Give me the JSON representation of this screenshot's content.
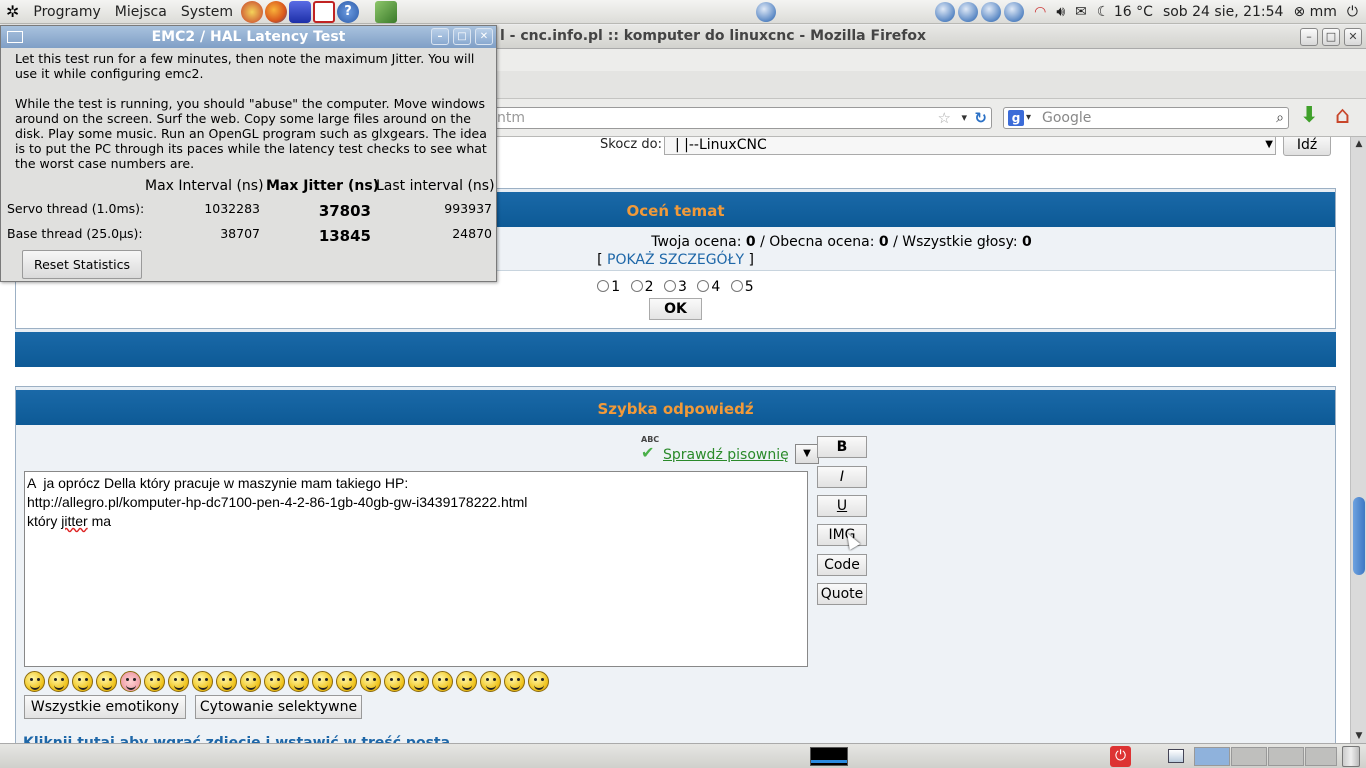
{
  "top_panel": {
    "menus": [
      "Programy",
      "Miejsca",
      "System"
    ],
    "weather": "16 °C",
    "datetime": "sob 24 sie, 21:54",
    "user": "mm"
  },
  "firefox": {
    "title": "l - cnc.info.pl :: komputer do linuxcnc - Mozilla Firefox",
    "url_fragment": "ntm",
    "search_placeholder": "Google"
  },
  "page": {
    "jump_label": "Skocz do:",
    "jump_value": "|   |--LinuxCNC",
    "go_button": "Idź",
    "rate": {
      "title": "Oceń temat",
      "your_rating_label": "Twoja ocena:",
      "your_rating": "0",
      "current_rating_label": "/ Obecna ocena:",
      "current_rating": "0",
      "all_votes_label": "/ Wszystkie głosy:",
      "all_votes": "0",
      "details_link": "POKAŻ SZCZEGÓŁY",
      "options": [
        "1",
        "2",
        "3",
        "4",
        "5"
      ],
      "ok_button": "OK"
    },
    "reply": {
      "title": "Szybka odpowiedź",
      "spell_link": "Sprawdź pisownię",
      "spell_badge": "ABC",
      "text_line1": "A  ja oprócz Della który pracuje w maszynie mam takiego HP:",
      "text_line2": "http://allegro.pl/komputer-hp-dc7100-pen-4-2-86-1gb-40gb-gw-i3439178222.html",
      "text_line3a": "który ",
      "text_line3b": "jitter",
      "text_line3c": " ma",
      "format_buttons": [
        "B",
        "I",
        "U",
        "IMG",
        "Code",
        "Quote"
      ],
      "all_emoticons": "Wszystkie emotikony",
      "selective_quote": "Cytowanie selektywne",
      "bottom_link": "Kliknij tutaj aby wgrać zdjęcie i wstawić w treść posta"
    }
  },
  "emc": {
    "title": "EMC2 / HAL Latency Test",
    "para1": "Let this test run for a few minutes, then note the maximum Jitter.  You will use it while configuring emc2.",
    "para2": "While the test is running, you should \"abuse\" the computer. Move windows around on the screen. Surf the web. Copy some large files around on the disk. Play some music. Run an OpenGL program such as glxgears. The idea is to put the PC through its paces while the latency test checks to see what the worst case numbers are.",
    "headers": {
      "max_interval": "Max Interval (ns)",
      "max_jitter": "Max Jitter (ns)",
      "last_interval": "Last interval (ns)"
    },
    "rows": [
      {
        "label": "Servo thread (1.0ms):",
        "max_interval": "1032283",
        "max_jitter": "37803",
        "last_interval": "993937"
      },
      {
        "label": "Base thread (25.0µs):",
        "max_interval": "38707",
        "max_jitter": "13845",
        "last_interval": "24870"
      }
    ],
    "reset_button": "Reset Statistics"
  },
  "icons": [
    "ubuntu-logo-icon",
    "firefox-icon",
    "help-icon",
    "network-icon",
    "volume-icon",
    "mail-icon",
    "moon-icon",
    "power-icon",
    "trash-icon"
  ]
}
